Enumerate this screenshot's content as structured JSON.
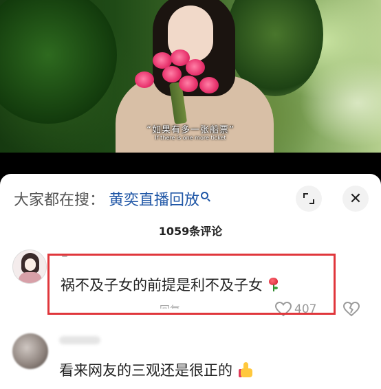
{
  "video": {
    "subtitle_cn": "“如果有多一张船票”",
    "subtitle_en": "If there is one more ticket"
  },
  "comments_panel": {
    "search_label": "大家都在搜：",
    "search_term": "黄奕直播回放",
    "comment_count": "1059条评论",
    "close_symbol": "✕"
  },
  "comments": [
    {
      "text": "祸不及子女的前提是利不及子女",
      "emoji": "rose-icon",
      "meta_partial": "回复",
      "like_count": "407",
      "highlighted": true
    },
    {
      "text": "看来网友的三观还是很正的",
      "emoji": "thumbs-up-icon"
    }
  ],
  "colors": {
    "link_blue": "#1f56a6",
    "highlight_red": "#e0363b",
    "sheet_bg": "#ffffff",
    "button_bg": "#f2f2f2"
  }
}
